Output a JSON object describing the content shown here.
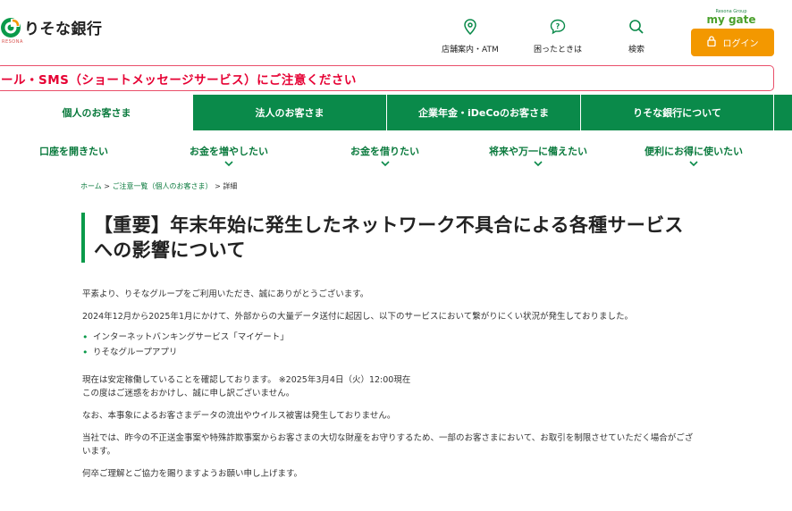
{
  "header": {
    "logo_text": "りそな銀行",
    "logo_sub": "RESONA",
    "utilities": [
      {
        "label": "店舗案内・ATM",
        "icon": "map-pin-icon"
      },
      {
        "label": "困ったときは",
        "icon": "help-bubble-icon"
      },
      {
        "label": "検索",
        "icon": "search-icon"
      }
    ],
    "mygate_small": "Resona Group",
    "mygate_brand": "my gate",
    "login_label": "ログイン"
  },
  "alert": {
    "text": "ール・SMS（ショートメッセージサービス）にご注意ください"
  },
  "tabs": [
    {
      "label": "個人のお客さま",
      "active": true
    },
    {
      "label": "法人のお客さま",
      "active": false
    },
    {
      "label": "企業年金・iDeCoのお客さま",
      "active": false
    },
    {
      "label": "りそな銀行について",
      "active": false
    }
  ],
  "subnav": [
    {
      "label": "口座を開きたい",
      "has_chevron": false
    },
    {
      "label": "お金を増やしたい",
      "has_chevron": true
    },
    {
      "label": "お金を借りたい",
      "has_chevron": true
    },
    {
      "label": "将来や万一に備えたい",
      "has_chevron": true
    },
    {
      "label": "便利にお得に使いたい",
      "has_chevron": true
    }
  ],
  "breadcrumb": {
    "home": "ホーム",
    "sep1": " > ",
    "list": "ご注意一覧（個人のお客さま）",
    "sep2": " > ",
    "current": "詳細"
  },
  "article": {
    "title": "【重要】年末年始に発生したネットワーク不具合による各種サービスへの影響について",
    "p1": "平素より、りそなグループをご利用いただき、誠にありがとうございます。",
    "p2": "2024年12月から2025年1月にかけて、外部からの大量データ送付に起因し、以下のサービスにおいて繋がりにくい状況が発生しておりました。",
    "services": [
      "インターネットバンキングサービス「マイゲート」",
      "りそなグループアプリ"
    ],
    "p3a": "現在は安定稼働していることを確認しております。 ※2025年3月4日（火）12:00現在",
    "p3b": "この度はご迷惑をおかけし、誠に申し訳ございません。",
    "p4": "なお、本事象によるお客さまデータの流出やウイルス被害は発生しておりません。",
    "p5": "当社では、昨今の不正送金事案や特殊詐欺事案からお客さまの大切な財産をお守りするため、一部のお客さまにおいて、お取引を制限させていただく場合がございます。",
    "p6": "何卒ご理解とご協力を賜りますようお願い申し上げます。"
  },
  "colors": {
    "brand_green": "#0a8a4a",
    "alert_red": "#e60033",
    "login_orange": "#f39800"
  }
}
